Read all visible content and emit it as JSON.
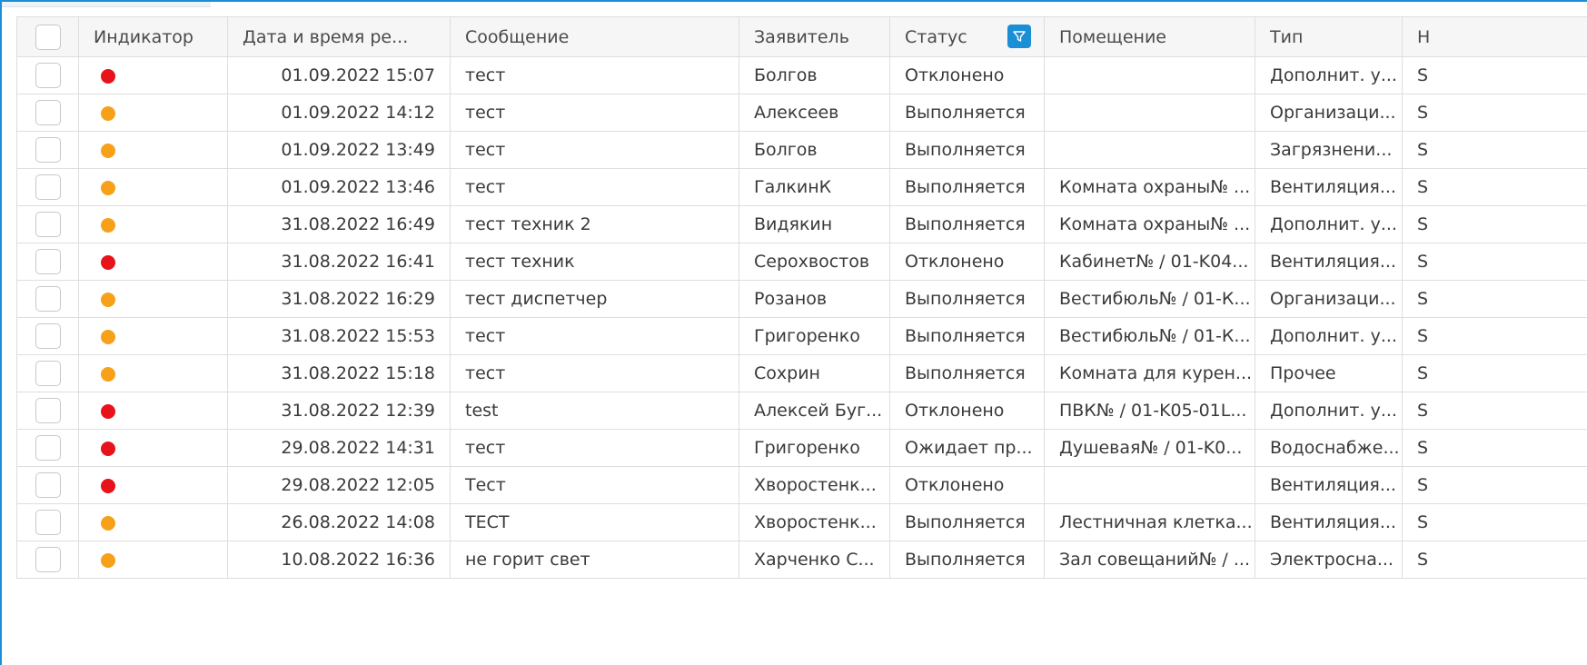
{
  "colors": {
    "indicator_red": "#e8121b",
    "indicator_orange": "#f7a11a",
    "accent": "#1a8fd6",
    "link": "#1f6fb5"
  },
  "columns": {
    "indicator": "Индикатор",
    "datetime": "Дата и время ре...",
    "message": "Сообщение",
    "applicant": "Заявитель",
    "status": "Статус",
    "room": "Помещение",
    "type": "Тип",
    "extra": "Н"
  },
  "status_filter_icon": "filter-icon",
  "rows": [
    {
      "indicator": "red",
      "datetime": "01.09.2022 15:07",
      "message": "тест",
      "applicant": "Болгов",
      "status": "Отклонено",
      "room": "",
      "type": "Дополнит. у...",
      "extra": "S"
    },
    {
      "indicator": "orange",
      "datetime": "01.09.2022 14:12",
      "message": "тест",
      "applicant": "Алексеев",
      "status": "Выполняется",
      "room": "",
      "type": "Организаци...",
      "extra": "S"
    },
    {
      "indicator": "orange",
      "datetime": "01.09.2022 13:49",
      "message": "тест",
      "applicant": "Болгов",
      "status": "Выполняется",
      "room": "",
      "type": "Загрязнени...",
      "extra": "S"
    },
    {
      "indicator": "orange",
      "datetime": "01.09.2022 13:46",
      "message": "тест",
      "applicant": "ГалкинК",
      "status": "Выполняется",
      "room": "Комната охраны№ ...",
      "type": "Вентиляция...",
      "extra": "S"
    },
    {
      "indicator": "orange",
      "datetime": "31.08.2022 16:49",
      "message": "тест техник 2",
      "applicant": "Видякин",
      "status": "Выполняется",
      "room": "Комната охраны№ ...",
      "type": "Дополнит. у...",
      "extra": "S"
    },
    {
      "indicator": "red",
      "datetime": "31.08.2022 16:41",
      "message": "тест техник",
      "applicant": "Серохвостов",
      "status": "Отклонено",
      "room": "Кабинет№ / 01-K04...",
      "type": "Вентиляция...",
      "extra": "S"
    },
    {
      "indicator": "orange",
      "datetime": "31.08.2022 16:29",
      "message": "тест диспетчер",
      "applicant": "Розанов",
      "status": "Выполняется",
      "room": "Вестибюль№ / 01-К...",
      "type": "Организаци...",
      "extra": "S"
    },
    {
      "indicator": "orange",
      "datetime": "31.08.2022 15:53",
      "message": "тест",
      "applicant": "Григоренко",
      "status": "Выполняется",
      "room": "Вестибюль№ / 01-К...",
      "type": "Дополнит. у...",
      "extra": "S"
    },
    {
      "indicator": "orange",
      "datetime": "31.08.2022 15:18",
      "message": "тест",
      "applicant": "Сохрин",
      "status": "Выполняется",
      "room": "Комната для курен...",
      "type": "Прочее",
      "extra": "S"
    },
    {
      "indicator": "red",
      "datetime": "31.08.2022 12:39",
      "message": "test",
      "applicant": "Алексей Буг...",
      "status": "Отклонено",
      "room": "ПВК№ / 01-K05-01L...",
      "type": "Дополнит. у...",
      "extra": "S"
    },
    {
      "indicator": "red",
      "datetime": "29.08.2022 14:31",
      "message": "тест",
      "applicant": "Григоренко",
      "status": "Ожидает пр...",
      "room": "Душевая№ / 01-K0...",
      "type": "Водоснабже...",
      "extra": "S"
    },
    {
      "indicator": "red",
      "datetime": "29.08.2022 12:05",
      "message": "Тест",
      "applicant": "Хворостенк...",
      "status": "Отклонено",
      "room": "",
      "type": "Вентиляция...",
      "extra": "S"
    },
    {
      "indicator": "orange",
      "datetime": "26.08.2022 14:08",
      "message": "ТЕСТ",
      "applicant": "Хворостенк...",
      "status": "Выполняется",
      "room": "Лестничная клетка...",
      "type": "Вентиляция...",
      "extra": "S"
    },
    {
      "indicator": "orange",
      "datetime": "10.08.2022 16:36",
      "message": "не горит свет",
      "applicant": "Харченко С...",
      "status": "Выполняется",
      "room": "Зал совещаний№ / ...",
      "type": "Электросна...",
      "extra": "S"
    }
  ]
}
